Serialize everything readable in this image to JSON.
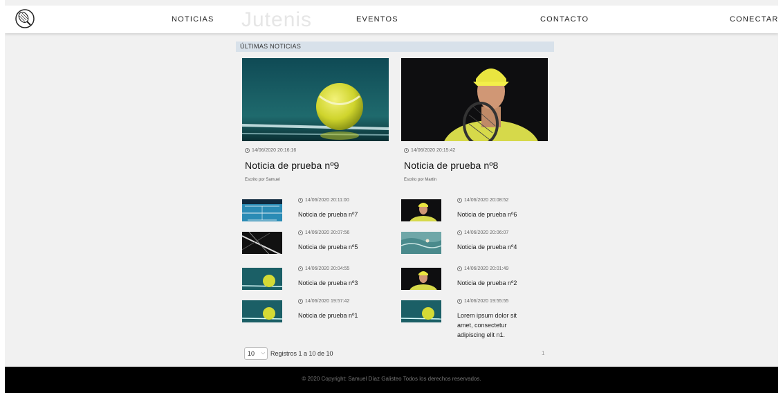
{
  "nav": {
    "watermark": "Jutenis",
    "items": [
      "NOTICIAS",
      "EVENTOS",
      "CONTACTO",
      "CONECTAR"
    ]
  },
  "section_title": "ÚLTIMAS NOTICIAS",
  "featured": [
    {
      "date": "14/06/2020 20:16:16",
      "title": "Noticia de prueba nº9",
      "author": "Escrito por Samuel",
      "image": "tennis-ball"
    },
    {
      "date": "14/06/2020 20:15:42",
      "title": "Noticia de prueba nº8",
      "author": "Escrito por Martin",
      "image": "player-portrait"
    }
  ],
  "items": [
    {
      "date": "14/06/2020 20:11:00",
      "title": "Noticia de prueba nº7",
      "image": "court"
    },
    {
      "date": "14/06/2020 20:08:52",
      "title": "Noticia de prueba nº6",
      "image": "player-portrait"
    },
    {
      "date": "14/06/2020 20:07:56",
      "title": "Noticia de prueba nº5",
      "image": "net-closeup"
    },
    {
      "date": "14/06/2020 20:06:07",
      "title": "Noticia de prueba nº4",
      "image": "water"
    },
    {
      "date": "14/06/2020 20:04:55",
      "title": "Noticia de prueba nº3",
      "image": "tennis-ball"
    },
    {
      "date": "14/06/2020 20:01:49",
      "title": "Noticia de prueba nº2",
      "image": "player-portrait"
    },
    {
      "date": "14/06/2020 19:57:42",
      "title": "Noticia de prueba nº1",
      "image": "tennis-ball"
    },
    {
      "date": "14/06/2020 19:55:55",
      "title": "Lorem ipsum dolor sit amet, consectetur adipiscing elit n1.",
      "image": "tennis-ball"
    }
  ],
  "pagination": {
    "per_page": "10",
    "records": "Registros 1 a 10 de 10",
    "page": "1"
  },
  "footer": {
    "copyright": "© 2020 Copyright: Samuel Díaz Galisteo Todos los derechos reservados."
  }
}
